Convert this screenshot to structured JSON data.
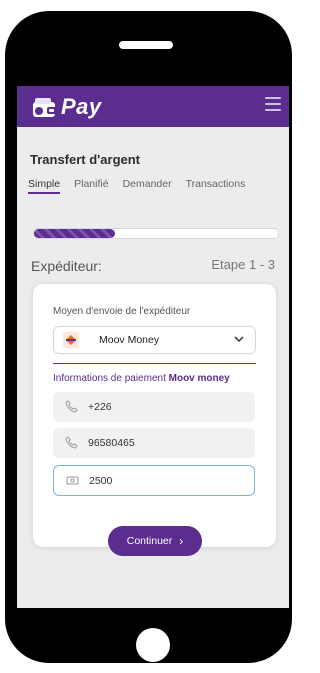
{
  "app": {
    "brand": "Pay"
  },
  "page": {
    "title": "Transfert d'argent"
  },
  "tabs": [
    {
      "label": "Simple"
    },
    {
      "label": "Planifié"
    },
    {
      "label": "Demander"
    },
    {
      "label": "Transactions"
    }
  ],
  "progress": {
    "fraction": 0.33
  },
  "step": {
    "section": "Expéditeur:",
    "indicator": "Etape 1 - 3"
  },
  "form": {
    "method_label": "Moyen d'envoie de l'expéditeur",
    "method_value": "Moov Money",
    "payment_info_prefix": "Informations de paiement ",
    "payment_info_provider": "Moov money",
    "country_code": "+226",
    "phone_number": "96580465",
    "amount": "2500"
  },
  "actions": {
    "continue_label": "Continuer"
  },
  "colors": {
    "brand": "#5b2d8e",
    "moov": "#f26b2a",
    "input_focus": "#7fb3de"
  },
  "icons": [
    "wallet-icon",
    "menu-icon",
    "moov-logo-icon",
    "chevron-down-icon",
    "phone-icon",
    "money-icon",
    "chevron-right-icon"
  ]
}
